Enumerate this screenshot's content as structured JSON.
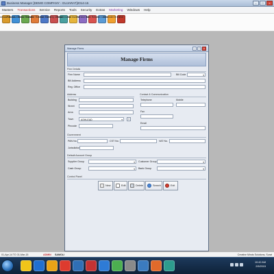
{
  "app": {
    "title": "Business Manager [DEMO COMPANY - GUJARAT]2014-15"
  },
  "menu": [
    "Masters",
    "Transactions",
    "Service",
    "Reports",
    "Tools",
    "Security",
    "Extras",
    "Marketing",
    "Windows",
    "Help"
  ],
  "menu_colors": [
    "#1a1a1a",
    "#c0262c",
    "#1a1a1a",
    "#1a1a1a",
    "#1a1a1a",
    "#1a1a1a",
    "#1a1a1a",
    "#7b2fa0",
    "#1a1a1a",
    "#1a1a1a"
  ],
  "toolbar": [
    {
      "label": "Purchase Bsmtl",
      "icon": "purchase-icon",
      "color": "#d99a2b"
    },
    {
      "label": "Purchase Return",
      "icon": "purchase-return-icon",
      "color": "#3f8fd6"
    },
    {
      "label": "Goods Transfer",
      "icon": "goods-transfer-icon",
      "color": "#6aa84f"
    },
    {
      "label": "Transfer Receive",
      "icon": "transfer-receive-icon",
      "color": "#e07b39"
    },
    {
      "label": "Order Form",
      "icon": "order-form-icon",
      "color": "#4d78c7"
    },
    {
      "label": "Delivery Challan",
      "icon": "delivery-challan-icon",
      "color": "#c94f4f"
    },
    {
      "label": "Retail Invoice",
      "icon": "retail-invoice-icon",
      "color": "#4aa0a0"
    },
    {
      "label": "Tax Invoice",
      "icon": "tax-invoice-icon",
      "color": "#e6b53c"
    },
    {
      "label": "Service Bill",
      "icon": "service-bill-icon",
      "color": "#8c6cc2"
    },
    {
      "label": "Sale Return",
      "icon": "sale-return-icon",
      "color": "#d9534f"
    },
    {
      "label": "Job Cards",
      "icon": "job-cards-icon",
      "color": "#5b9bd5"
    },
    {
      "label": "Reminder Entry",
      "icon": "reminder-entry-icon",
      "color": "#f0a030"
    },
    {
      "label": "Exit",
      "icon": "exit-icon",
      "color": "#c0392b"
    }
  ],
  "window": {
    "title": "Manage Firms",
    "heading": "Manage Firms"
  },
  "form": {
    "firm_details": "Firm Details",
    "firm_name": "Firm Name",
    "bill_code": "Bill Code",
    "bill_address": "Bill Address",
    "reg_office": "Reg. Office",
    "address": "Address",
    "building": "Building",
    "street": "Street",
    "area": "Area",
    "town": "Town",
    "town_value": "ASHLEAD",
    "pincode": "Pincode",
    "contact": "Contact & Communication",
    "telephone": "Telephone",
    "mobile": "Mobile",
    "fax": "Fax",
    "email": "Email",
    "government": "Government",
    "pan_no": "PAN No.",
    "cst_no": "CST No.",
    "vat_no": "VAT No.",
    "jurisdiction": "Jurisdiction",
    "default_account_group": "Default Account Group",
    "supplier_group": "Supplier Group",
    "customer_group": "Customer Group",
    "cash_group": "Cash Group",
    "bank_group": "Bank Group",
    "control_panel": "Control Panel"
  },
  "buttons": {
    "new": "New",
    "edit": "Edit",
    "delete": "Delete",
    "search": "Search",
    "exit": "Exit"
  },
  "statusbar": {
    "date": "01-Apr-14 TO 31-Mar-15",
    "user": "ADMIN",
    "location": "SAMOLI",
    "company": "Creative Minds Solutions, Surat"
  },
  "taskbar": {
    "time": "10:42 AM",
    "date": "2/5/2015"
  }
}
